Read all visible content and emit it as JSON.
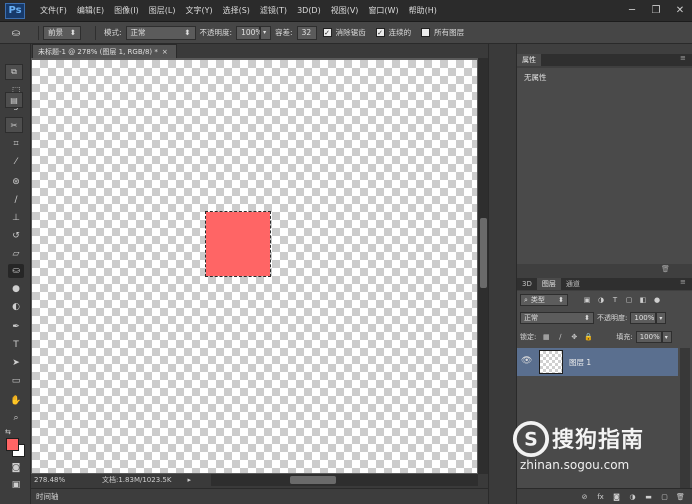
{
  "app": {
    "logo": "Ps"
  },
  "menu": [
    "文件(F)",
    "编辑(E)",
    "图像(I)",
    "图层(L)",
    "文字(Y)",
    "选择(S)",
    "滤镜(T)",
    "3D(D)",
    "视图(V)",
    "窗口(W)",
    "帮助(H)"
  ],
  "window_controls": {
    "minimize": "─",
    "restore": "❐",
    "close": "✕"
  },
  "options": {
    "tool_icon": "paint-bucket-icon",
    "fill_source": "前景",
    "mode_label": "模式:",
    "mode_value": "正常",
    "opacity_label": "不透明度:",
    "opacity_value": "100%",
    "tolerance_label": "容差:",
    "tolerance_value": "32",
    "antialias_label": "消除锯齿",
    "antialias_checked": true,
    "contiguous_label": "连续的",
    "contiguous_checked": true,
    "all_layers_label": "所有图层",
    "all_layers_checked": false
  },
  "document": {
    "tab_title": "未标题-1 @ 278% (图层 1, RGB/8) *",
    "tab_close": "×",
    "zoom": "278.48%",
    "doc_size": "文档:1.83M/1023.5K",
    "fill_color": "#ff6565"
  },
  "timeline": {
    "label": "时间轴"
  },
  "properties": {
    "tab_label": "属性",
    "empty_text": "无属性"
  },
  "layers_panel": {
    "tabs": [
      "3D",
      "图层",
      "通道"
    ],
    "active_tab": "图层",
    "filter_kind": "类型",
    "blend_mode": "正常",
    "opacity_label": "不透明度:",
    "opacity_value": "100%",
    "lock_label": "锁定:",
    "fill_label": "填充:",
    "fill_value": "100%",
    "layers": [
      {
        "name": "图层 1",
        "visible": true,
        "selected": true
      }
    ]
  },
  "colors": {
    "foreground": "#ff6565",
    "background": "#ffffff",
    "selection": "#5a6f8f"
  },
  "watermark": {
    "brand": "搜狗指南",
    "url": "zhinan.sogou.com"
  }
}
